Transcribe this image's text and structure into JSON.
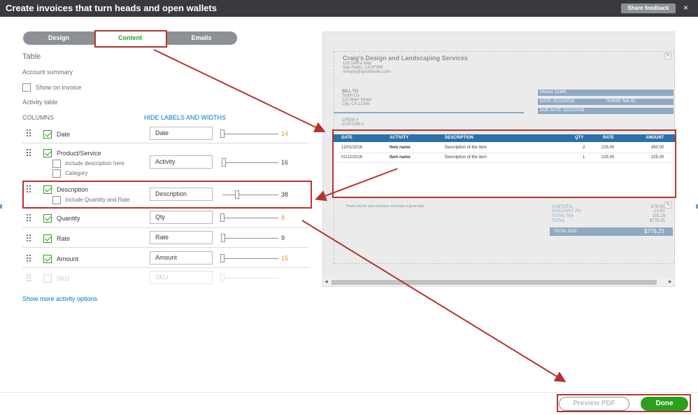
{
  "header": {
    "title": "Create invoices that turn heads and open wallets",
    "share_feedback": "Share feedback",
    "close": "×"
  },
  "tabs": [
    {
      "label": "Design"
    },
    {
      "label": "Content",
      "active": true
    },
    {
      "label": "Emails"
    }
  ],
  "left": {
    "section_title": "Table",
    "account_summary": "Account summary",
    "show_on_invoice": "Show on invoice",
    "activity_table": "Activity table",
    "columns_label": "COLUMNS",
    "hide_labels_link": "HIDE LABELS AND WIDTHS",
    "show_more_link": "Show more activity options",
    "rows": [
      {
        "name": "Date",
        "checked": true,
        "label_value": "Date",
        "width": "14",
        "highlight": true
      },
      {
        "name": "Product/Service",
        "checked": true,
        "label_value": "Activity",
        "width": "16",
        "suboptions": [
          "Include description here",
          "Category"
        ]
      },
      {
        "name": "Description",
        "checked": true,
        "label_value": "Description",
        "width": "38",
        "suboptions": [
          "Include Quantity and Rate"
        ]
      },
      {
        "name": "Quantity",
        "checked": true,
        "label_value": "Qty",
        "width": "8",
        "highlight": true
      },
      {
        "name": "Rate",
        "checked": true,
        "label_value": "Rate",
        "width": "9"
      },
      {
        "name": "Amount",
        "checked": true,
        "label_value": "Amount",
        "width": "15",
        "highlight": true
      },
      {
        "name": "SKU",
        "checked": false,
        "label_value": "SKU",
        "width": "",
        "disabled": true
      }
    ]
  },
  "preview": {
    "company": "Craig's Design and Landscaping Services",
    "address1": "123 Sierra Way",
    "address2": "San Pablo, CA 87999",
    "email": "noreply@quickbooks.com",
    "bill_to_label": "BILL TO",
    "bill_to": [
      "Smith Co.",
      "123 Main Street",
      "City, CA 12345"
    ],
    "invoice_no": "Invoice 12345",
    "date": "DATE: 01/12/2016",
    "terms": "TERMS: Net 30",
    "due_date": "DUE DATE: 02/12/2016",
    "crew_label": "CREW #",
    "crew_value": "CUSTOM-1",
    "table_headers": [
      "DATE",
      "ACTIVITY",
      "DESCRIPTION",
      "QTY",
      "RATE",
      "AMOUNT"
    ],
    "table_rows": [
      [
        "12/01/2016",
        "Item name",
        "Description of the item",
        "2",
        "225.00",
        "450.00"
      ],
      [
        "01/12/2016",
        "Item name",
        "Description of the item",
        "1",
        "225.00",
        "225.00"
      ]
    ],
    "thanks": "Thank you for your business and have a great day!",
    "summary": [
      {
        "label": "SUBTOTAL",
        "value": "675.00"
      },
      {
        "label": "DISCOUNT 2%",
        "value": "-13.50"
      },
      {
        "label": "TOTAL TAX",
        "value": "101.25"
      },
      {
        "label": "TOTAL",
        "value": "$776.25"
      }
    ],
    "total_due_label": "TOTAL DUE",
    "total_due_value": "$776.25"
  },
  "footer": {
    "preview_pdf": "Preview PDF",
    "done": "Done"
  },
  "colors": {
    "brand_green": "#2ca01c",
    "header_dark": "#393a3d",
    "link_blue": "#0077c5",
    "annotation_red": "#b4352e",
    "highlight_orange": "#e89624",
    "table_blue": "#2d6fa8"
  }
}
